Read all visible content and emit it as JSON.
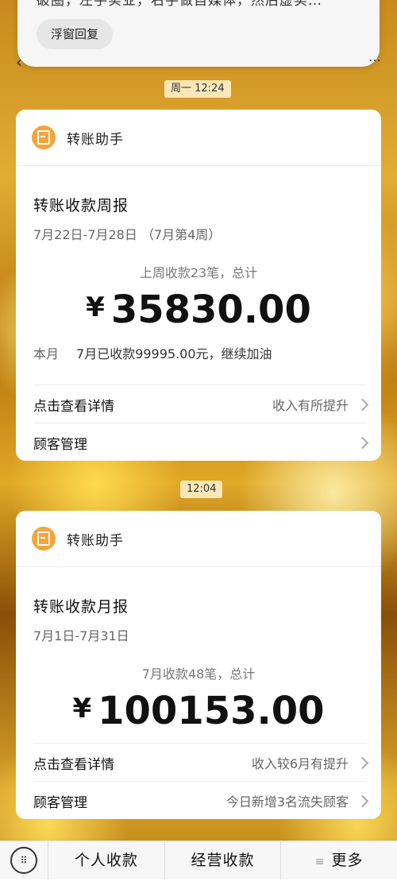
{
  "top": {
    "text": "破圈，左手实业，右手做自媒体，然后虚实…",
    "float_reply": "浮窗回复"
  },
  "stamps": {
    "first": "周一 12:24",
    "second": "12:04"
  },
  "card1": {
    "head_title": "转账助手",
    "title": "转账收款周报",
    "date": "7月22日-7月28日 （7月第4周）",
    "summary": "上周收款23笔，总计",
    "currency": "¥",
    "amount": "35830.00",
    "month_label": "本月",
    "month_text": "7月已收款99995.00元，继续加油",
    "row1_left": "点击查看详情",
    "row1_right": "收入有所提升",
    "row2_left": "顾客管理",
    "row2_right": ""
  },
  "card2": {
    "head_title": "转账助手",
    "title": "转账收款月报",
    "date": "7月1日-7月31日",
    "summary": "7月收款48笔，总计",
    "currency": "¥",
    "amount": "100153.00",
    "row1_left": "点击查看详情",
    "row1_right": "收入较6月有提升",
    "row2_left": "顾客管理",
    "row2_right": "今日新增3名流失顾客"
  },
  "bottom": {
    "tab1": "个人收款",
    "tab2": "经营收款",
    "tab3": "更多"
  }
}
